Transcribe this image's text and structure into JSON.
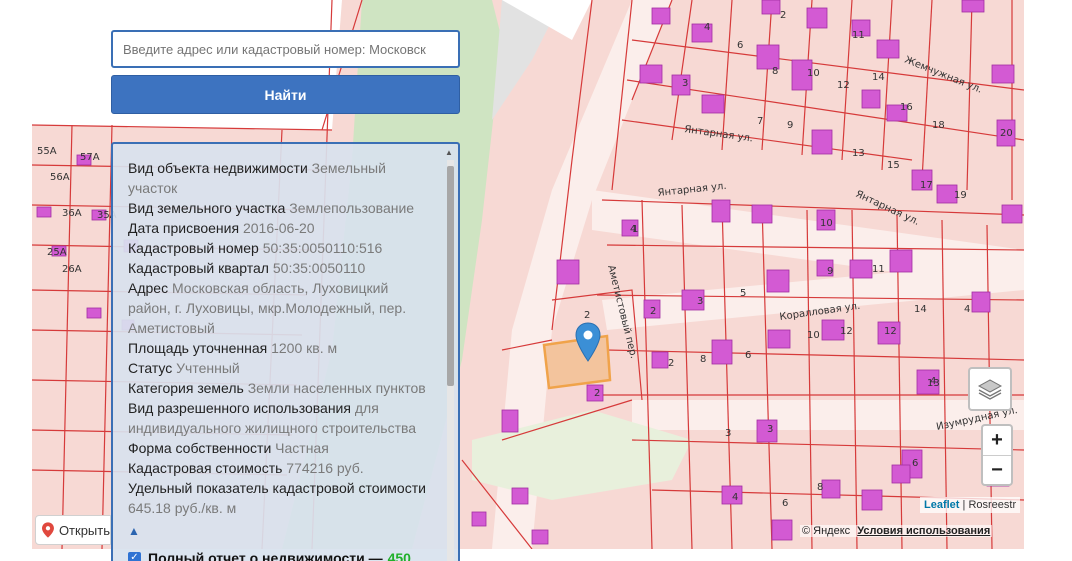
{
  "search": {
    "placeholder": "Введите адрес или кадастровый номер: Московск",
    "button_label": "Найти"
  },
  "info": {
    "rows": [
      {
        "label": "Вид объекта недвижимости",
        "value": "Земельный участок"
      },
      {
        "label": "Вид земельного участка",
        "value": "Землепользование"
      },
      {
        "label": "Дата присвоения",
        "value": "2016-06-20"
      },
      {
        "label": "Кадастровый номер",
        "value": "50:35:0050110:516"
      },
      {
        "label": "Кадастровый квартал",
        "value": "50:35:0050110"
      },
      {
        "label": "Адрес",
        "value": "Московская область, Луховицкий район, г. Луховицы, мкр.Молодежный, пер. Аметистовый"
      },
      {
        "label": "Площадь уточненная",
        "value": "1200 кв. м"
      },
      {
        "label": "Статус",
        "value": "Учтенный"
      },
      {
        "label": "Категория земель",
        "value": "Земли населенных пунктов"
      },
      {
        "label": "Вид разрешенного использования",
        "value": "для индивидуального жилищного строительства"
      },
      {
        "label": "Форма собственности",
        "value": "Частная"
      },
      {
        "label": "Кадастровая стоимость",
        "value": "774216 руб."
      },
      {
        "label": "Удельный показатель кадастровой стоимости",
        "value": "645.18 руб./кв. м"
      }
    ],
    "collapse_symbol": "▲",
    "report_label": "Полный отчет о недвижимости —",
    "report_price": "450"
  },
  "map": {
    "streets": [
      "Жемчужная ул.",
      "Янтарная ул.",
      "Янтарная ул.",
      "Янтарная ул.",
      "Аметистовый пер.",
      "Коралловая ул.",
      "Изумрудная ул."
    ],
    "plot_numbers": [
      "55А",
      "56А",
      "57А",
      "36А",
      "35А",
      "26А",
      "25А",
      "4",
      "6",
      "2",
      "11",
      "3",
      "8",
      "10",
      "12",
      "14",
      "16",
      "18",
      "20",
      "7",
      "9",
      "13",
      "15",
      "17",
      "19",
      "10",
      "9",
      "11",
      "2",
      "4",
      "5",
      "3",
      "2",
      "14",
      "8",
      "10",
      "12",
      "6",
      "4",
      "2",
      "3",
      "12",
      "2",
      "4",
      "6",
      "6",
      "8",
      "4",
      "3",
      "13",
      "1"
    ],
    "open_label": "Открыть",
    "attribution_leaflet": "Leaflet",
    "attribution_source": "Rosreestr",
    "yandex_copy": "© Яндекс",
    "yandex_terms": "Условия использования",
    "zoom_in": "+",
    "zoom_out": "−",
    "colors": {
      "parcel_fill": "#f7d9d4",
      "parcel_line": "#d63a3a",
      "building": "#d35ad3",
      "selected": "#f0a34a",
      "green": "#cfe4c2",
      "marker": "#3b8fd6"
    }
  }
}
